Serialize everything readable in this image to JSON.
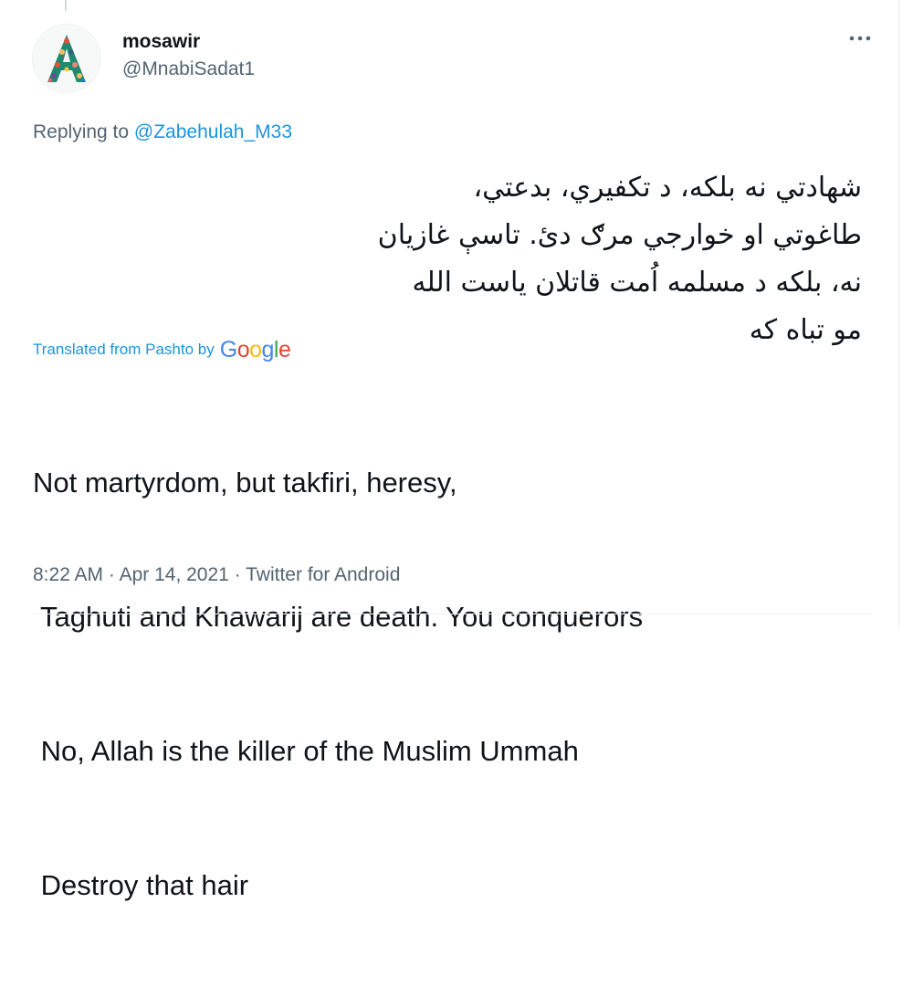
{
  "tweet": {
    "author": {
      "display_name": "mosawir",
      "handle": "@MnabiSadat1",
      "avatar_icon": "letter-a-avatar-icon"
    },
    "more_icon": "more-options-icon",
    "replying_to": {
      "prefix": "Replying to",
      "mention": "@Zabehulah_M33"
    },
    "original_text_lines": [
      "شهادتي نه بلکه، د تکفيري، بدعتي،",
      "طاغوتي او خوارجي مرګ دئ. تاسې غازيان",
      "نه، بلکه د مسلمه اُمت قاتلان ياست الله",
      "مو تباه که"
    ],
    "translation": {
      "label": "Translated from Pashto by",
      "provider": "Google",
      "provider_colors": [
        "#4285F4",
        "#EA4335",
        "#FBBC05",
        "#4285F4",
        "#34A853",
        "#EA4335"
      ],
      "lines": [
        "Not martyrdom, but takfiri, heresy,",
        " Taghuti and Khawarij are death. You conquerors",
        " No, Allah is the killer of the Muslim Ummah",
        " Destroy that hair"
      ]
    },
    "meta": {
      "time": "8:22 AM",
      "separator": " · ",
      "date": "Apr 14, 2021",
      "source": "Twitter for Android"
    },
    "colors": {
      "link": "#1B95E0",
      "secondary_text": "#536471",
      "primary_text": "#0F1419"
    }
  }
}
